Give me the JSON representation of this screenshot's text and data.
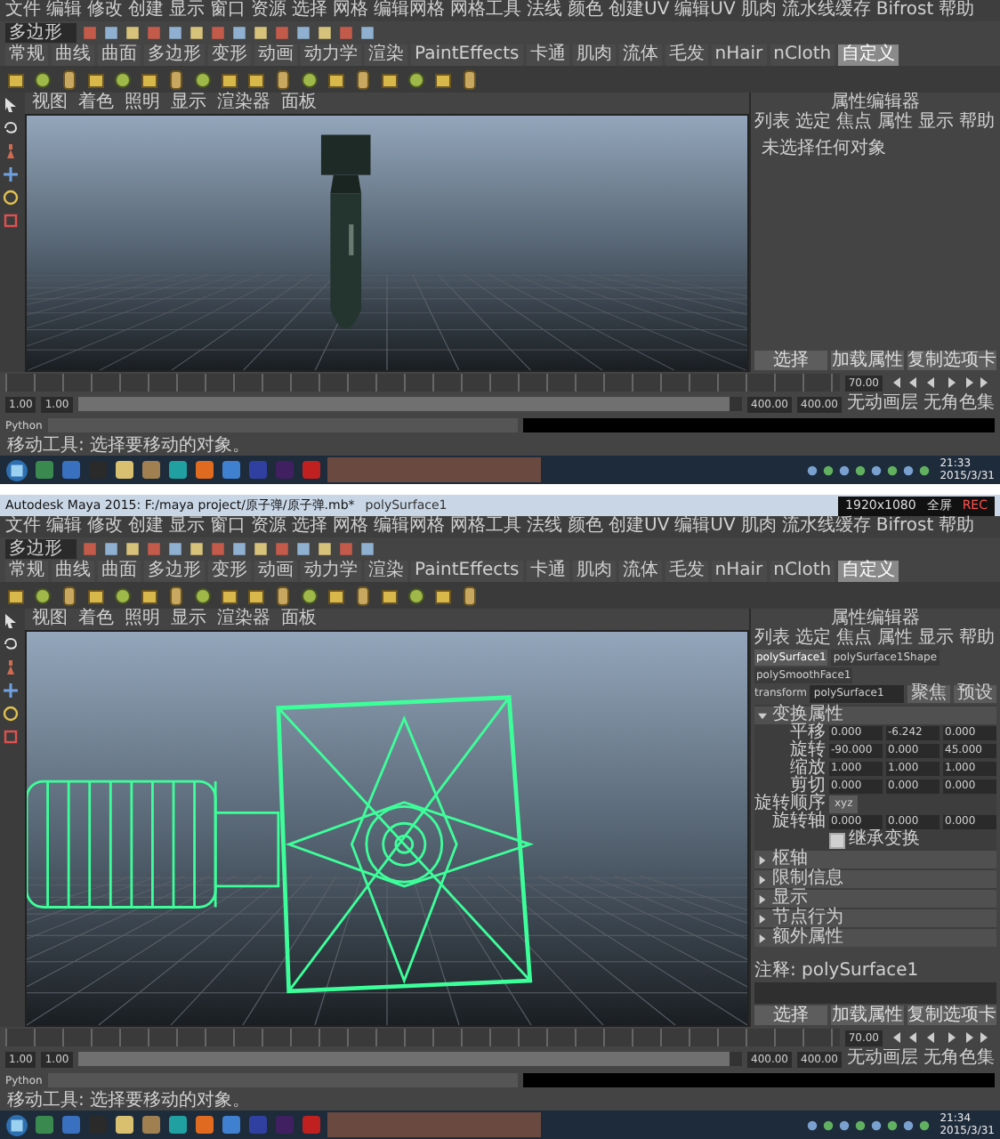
{
  "screenshots": [
    {
      "menu": [
        "文件",
        "编辑",
        "修改",
        "创建",
        "显示",
        "窗口",
        "资源",
        "选择",
        "网格",
        "编辑网格",
        "网格工具",
        "法线",
        "颜色",
        "创建UV",
        "编辑UV",
        "肌肉",
        "流水线缓存",
        "Bifrost",
        "帮助"
      ],
      "mode": "多边形",
      "shelf_tabs": [
        {
          "label": "常规",
          "selected": false
        },
        {
          "label": "曲线",
          "selected": false
        },
        {
          "label": "曲面",
          "selected": false
        },
        {
          "label": "多边形",
          "selected": false
        },
        {
          "label": "变形",
          "selected": false
        },
        {
          "label": "动画",
          "selected": false
        },
        {
          "label": "动力学",
          "selected": false
        },
        {
          "label": "渲染",
          "selected": false
        },
        {
          "label": "PaintEffects",
          "selected": false
        },
        {
          "label": "卡通",
          "selected": false
        },
        {
          "label": "肌肉",
          "selected": false
        },
        {
          "label": "流体",
          "selected": false
        },
        {
          "label": "毛发",
          "selected": false
        },
        {
          "label": "nHair",
          "selected": false
        },
        {
          "label": "nCloth",
          "selected": false
        },
        {
          "label": "自定义",
          "selected": true
        }
      ],
      "panel_menu": [
        "视图",
        "着色",
        "照明",
        "显示",
        "渲染器",
        "面板"
      ],
      "viewport": {
        "kind": "bomb"
      },
      "attribute_editor": {
        "title": "属性编辑器",
        "menu": [
          "列表",
          "选定",
          "焦点",
          "属性",
          "显示",
          "帮助"
        ],
        "message": "未选择任何对象",
        "buttons": [
          "选择",
          "加载属性",
          "复制选项卡"
        ]
      },
      "timeline": {
        "current": "70.00",
        "range": [
          "1.00",
          "1.00",
          "400.00",
          "400.00"
        ],
        "range_slider": {
          "level": 0.98
        },
        "anim_layer": "无动画层",
        "char_set": "无角色集"
      },
      "command": "Python",
      "help_line": "移动工具: 选择要移动的对象。",
      "clock": {
        "time": "21:33",
        "date": "2015/3/31"
      }
    },
    {
      "title_bar": {
        "title": "Autodesk Maya 2015: F:/maya project/原子弹/原子弹.mb*",
        "selection": "polySurface1",
        "resolution": "1920x1080",
        "mode": "全屏",
        "rec": "REC"
      },
      "menu": [
        "文件",
        "编辑",
        "修改",
        "创建",
        "显示",
        "窗口",
        "资源",
        "选择",
        "网格",
        "编辑网格",
        "网格工具",
        "法线",
        "颜色",
        "创建UV",
        "编辑UV",
        "肌肉",
        "流水线缓存",
        "Bifrost",
        "帮助"
      ],
      "mode": "多边形",
      "shelf_tabs": [
        {
          "label": "常规",
          "selected": false
        },
        {
          "label": "曲线",
          "selected": false
        },
        {
          "label": "曲面",
          "selected": false
        },
        {
          "label": "多边形",
          "selected": false
        },
        {
          "label": "变形",
          "selected": false
        },
        {
          "label": "动画",
          "selected": false
        },
        {
          "label": "动力学",
          "selected": false
        },
        {
          "label": "渲染",
          "selected": false
        },
        {
          "label": "PaintEffects",
          "selected": false
        },
        {
          "label": "卡通",
          "selected": false
        },
        {
          "label": "肌肉",
          "selected": false
        },
        {
          "label": "流体",
          "selected": false
        },
        {
          "label": "毛发",
          "selected": false
        },
        {
          "label": "nHair",
          "selected": false
        },
        {
          "label": "nCloth",
          "selected": false
        },
        {
          "label": "自定义",
          "selected": true
        }
      ],
      "panel_menu": [
        "视图",
        "着色",
        "照明",
        "显示",
        "渲染器",
        "面板"
      ],
      "viewport": {
        "kind": "wireframe"
      },
      "attribute_editor": {
        "title": "属性编辑器",
        "menu": [
          "列表",
          "选定",
          "焦点",
          "属性",
          "显示",
          "帮助"
        ],
        "node_tabs": [
          {
            "label": "polySurface1",
            "selected": true
          },
          {
            "label": "polySurface1Shape",
            "selected": false
          },
          {
            "label": "polySmoothFace1",
            "selected": false
          }
        ],
        "node_type": "transform",
        "node_name": "polySurface1",
        "side_buttons": [
          "聚焦",
          "预设"
        ],
        "sections": [
          {
            "label": "变换属性",
            "expanded": true,
            "rows": [
              {
                "kind": "vector",
                "label": "平移",
                "values": [
                  "0.000",
                  "-6.242",
                  "0.000"
                ]
              },
              {
                "kind": "vector",
                "label": "旋转",
                "values": [
                  "-90.000",
                  "0.000",
                  "45.000"
                ]
              },
              {
                "kind": "vector",
                "label": "缩放",
                "values": [
                  "1.000",
                  "1.000",
                  "1.000"
                ]
              },
              {
                "kind": "vector",
                "label": "剪切",
                "values": [
                  "0.000",
                  "0.000",
                  "0.000"
                ]
              },
              {
                "kind": "choice",
                "label": "旋转顺序",
                "value": "xyz"
              },
              {
                "kind": "vector",
                "label": "旋转轴",
                "values": [
                  "0.000",
                  "0.000",
                  "0.000"
                ]
              },
              {
                "kind": "check",
                "label": "继承变换",
                "checked": true
              }
            ]
          },
          {
            "label": "枢轴",
            "expanded": false
          },
          {
            "label": "限制信息",
            "expanded": false
          },
          {
            "label": "显示",
            "expanded": false
          },
          {
            "label": "节点行为",
            "expanded": false
          },
          {
            "label": "额外属性",
            "expanded": false
          }
        ],
        "notes": "注释: polySurface1",
        "buttons": [
          "选择",
          "加载属性",
          "复制选项卡"
        ]
      },
      "timeline": {
        "current": "70.00",
        "range": [
          "1.00",
          "1.00",
          "400.00",
          "400.00"
        ],
        "range_slider": {
          "level": 0.98
        },
        "anim_layer": "无动画层",
        "char_set": "无角色集"
      },
      "command": "Python",
      "help_line": "移动工具: 选择要移动的对象。",
      "clock": {
        "time": "21:34",
        "date": "2015/3/31"
      }
    }
  ]
}
